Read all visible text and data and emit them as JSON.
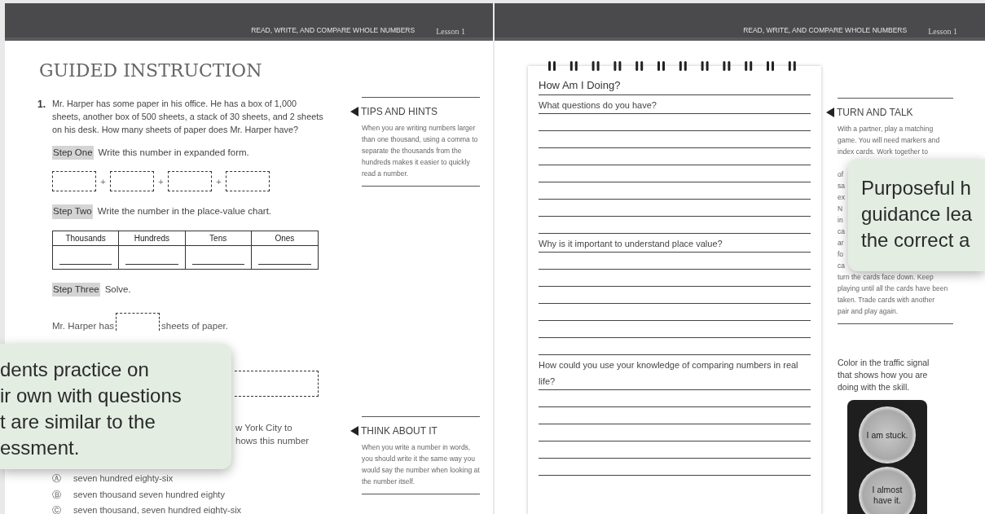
{
  "pages": [
    {
      "section": "READ, WRITE, AND COMPARE WHOLE NUMBERS",
      "lesson": "Lesson 1"
    },
    {
      "section": "READ, WRITE, AND COMPARE WHOLE NUMBERS",
      "lesson": "Lesson 1"
    }
  ],
  "guided": {
    "title": "GUIDED INSTRUCTION",
    "number": "1.",
    "question": "Mr. Harper has some paper in his office. He has a box of 1,000 sheets, another box of 500 sheets, a stack of 30 sheets, and 2 sheets on his desk. How many sheets of paper does Mr. Harper have?",
    "parts": [
      {
        "kind": "step",
        "label": "Step One",
        "text": "Write this number in expanded form."
      },
      {
        "kind": "expanded_form",
        "operators": [
          "+",
          "+",
          "+"
        ]
      },
      {
        "kind": "step",
        "label": "Step Two",
        "text": "Write the number in the place-value chart."
      },
      {
        "kind": "chart",
        "columns": [
          "Thousands",
          "Hundreds",
          "Tens",
          "Ones"
        ]
      },
      {
        "kind": "step",
        "label": "Step Three",
        "text": "Solve."
      },
      {
        "kind": "sentence",
        "before": "Mr. Harper has",
        "after": "sheets of paper."
      },
      {
        "kind": "answer_box"
      }
    ],
    "question_2_lines": [
      "w York City to",
      "hows this number"
    ],
    "options": [
      {
        "letter": "Ⓐ",
        "text": "seven hundred eighty-six"
      },
      {
        "letter": "Ⓑ",
        "text": "seven thousand seven hundred eighty"
      },
      {
        "letter": "Ⓒ",
        "text": "seven thousand, seven hundred eighty-six"
      }
    ]
  },
  "tips": {
    "title": "TIPS AND HINTS",
    "text": "When you are writing numbers larger than one thousand, using a comma to separate the thousands from the hundreds makes it easier to quickly read a number."
  },
  "think": {
    "title": "THINK ABOUT IT",
    "text": "When you write a number in words, you should write it the same way you would say the number when looking at the number itself."
  },
  "journal": {
    "title": "How Am I Doing?",
    "prompts": [
      "What questions do you have?",
      "Why is it important to understand place value?",
      "How could you use your knowledge of comparing numbers in real life?"
    ]
  },
  "turn_and_talk": {
    "title": "TURN AND TALK",
    "lines_above": [
      "With a partner, play a matching",
      "game. You will need markers and",
      "index cards. Work together to"
    ],
    "fragments": [
      "of",
      "sa",
      "ex",
      "N",
      "in",
      "ca",
      "ar",
      "fo",
      "ca"
    ],
    "lines_below": [
      "turn the cards face down. Keep",
      "playing until all the cards have been",
      "taken. Trade cards with another",
      "pair and play again."
    ]
  },
  "traffic_signal": {
    "instruction": "Color in the traffic signal that shows how you are doing with the skill.",
    "lights": [
      "I am stuck.",
      "I almost have it."
    ]
  },
  "callouts": [
    {
      "lines": [
        "dents practice on",
        "ir own with questions",
        "t are similar to the",
        "essment."
      ]
    },
    {
      "lines": [
        "Purposeful h",
        "guidance lea",
        "the correct a"
      ]
    }
  ]
}
